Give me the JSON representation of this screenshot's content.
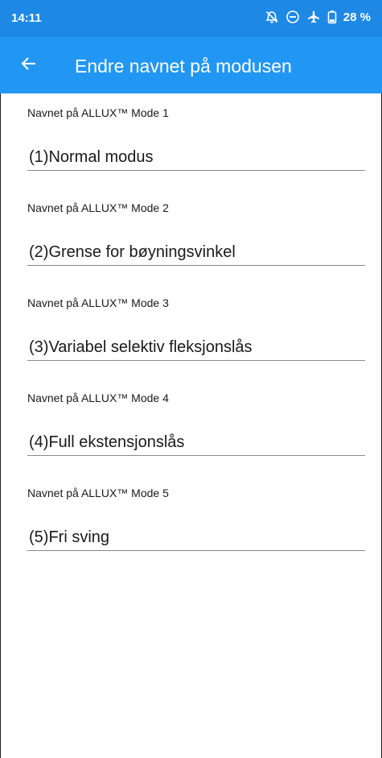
{
  "status_bar": {
    "time": "14:11",
    "battery": "28 %",
    "icons": [
      "alarm-off-icon",
      "do-not-disturb-icon",
      "airplane-mode-icon",
      "battery-icon"
    ]
  },
  "app_bar": {
    "title": "Endre navnet på modusen",
    "back_icon": "arrow-left-icon",
    "color": "#2196f3"
  },
  "fields": [
    {
      "label": "Navnet på ALLUX™ Mode 1",
      "value": "(1)Normal modus"
    },
    {
      "label": "Navnet på ALLUX™ Mode 2",
      "value": "(2)Grense for bøyningsvinkel"
    },
    {
      "label": "Navnet på ALLUX™ Mode 3",
      "value": "(3)Variabel selektiv fleksjonslås"
    },
    {
      "label": "Navnet på ALLUX™ Mode 4",
      "value": "(4)Full ekstensjonslås"
    },
    {
      "label": "Navnet på ALLUX™ Mode 5",
      "value": "(5)Fri sving"
    }
  ]
}
